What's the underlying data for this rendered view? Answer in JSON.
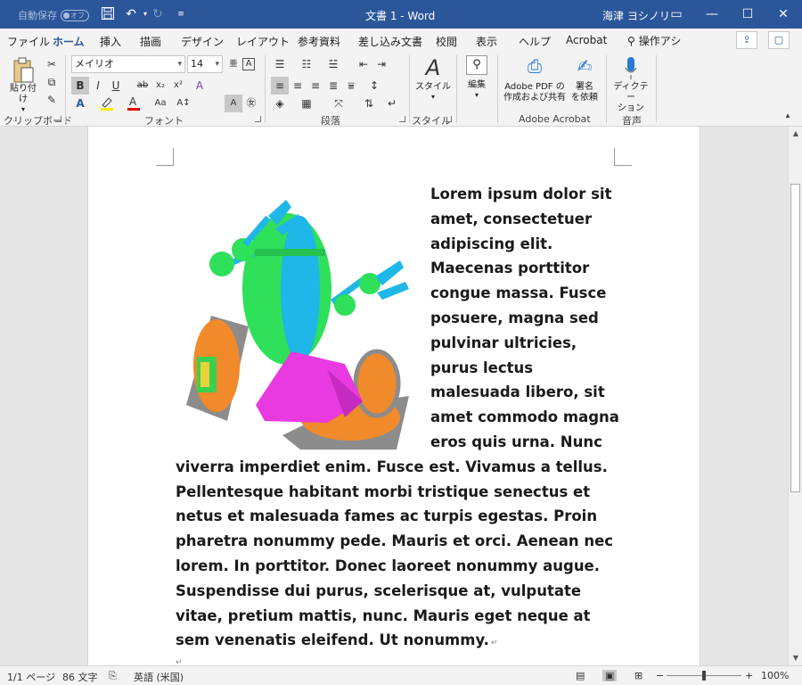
{
  "titlebar": {
    "autosave_label": "自動保存",
    "autosave_state": "オフ",
    "doc_title": "文書 1  -  Word",
    "user_name": "海津 ヨシノリ",
    "accent": "#2b579a"
  },
  "tabs": [
    "ファイル",
    "ホーム",
    "挿入",
    "描画",
    "デザイン",
    "レイアウト",
    "参考資料",
    "差し込み文書",
    "校閲",
    "表示",
    "ヘルプ",
    "Acrobat"
  ],
  "tell_me": "操作アシ",
  "ribbon": {
    "clipboard": {
      "paste_label": "貼り付け",
      "group": "クリップボード"
    },
    "font": {
      "name": "メイリオ",
      "size": "14",
      "group": "フォント"
    },
    "paragraph": {
      "group": "段落"
    },
    "styles": {
      "label": "スタイル",
      "group": "スタイル"
    },
    "editing": {
      "label": "編集"
    },
    "acrobat": {
      "create_line1": "Adobe PDF の",
      "create_line2": "作成および共有",
      "sign_line1": "署名",
      "sign_line2": "を依頼",
      "group": "Adobe Acrobat"
    },
    "voice": {
      "dictate_line1": "ディクテー",
      "dictate_line2": "ション",
      "group": "音声"
    }
  },
  "document": {
    "body_text": "Lorem ipsum dolor sit amet, consectetuer adipiscing elit. Maecenas porttitor congue massa. Fusce posuere, magna sed pulvinar ultricies, purus lectus malesuada libero, sit amet commodo magna eros quis urna. Nunc viverra imperdiet enim. Fusce est. Vivamus a tellus. Pellentesque habitant morbi tristique senectus et netus et malesuada fames ac turpis egestas. Proin pharetra nonummy pede. Mauris et orci. Aenean nec lorem. In porttitor. Donec laoreet nonummy augue. Suspendisse dui purus, scelerisque at, vulputate vitae, pretium mattis, nunc. Mauris eget neque at sem venenatis eleifend. Ut nonummy.",
    "image_subject": "robot-on-tracks"
  },
  "statusbar": {
    "page": "1/1 ページ",
    "words": "86 文字",
    "language": "英語 (米国)",
    "zoom": "100%"
  }
}
